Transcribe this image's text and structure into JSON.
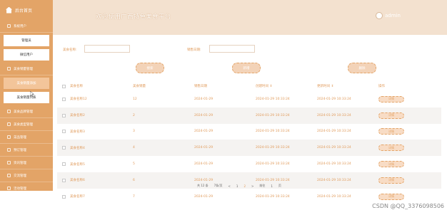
{
  "sidebar": {
    "home": "后台首页",
    "menu1": "系统用户",
    "sub1": [
      "管理员",
      "微信用户"
    ],
    "menu2": "美食销量管理",
    "sub2": [
      "美食销量添加",
      "美食销量列表"
    ],
    "menus": [
      "美食品牌管理",
      "美食类型管理",
      "菜品管理",
      "预订管理",
      "资讯管理",
      "交流管理",
      "活动管理"
    ]
  },
  "header": {
    "title": "欢迎使用广西特色美食平台",
    "user": "admin"
  },
  "search": {
    "name_label": "美食名称:",
    "date_label": "销售日期:",
    "btn_search": "搜索",
    "btn_add": "新增",
    "btn_delete": "删除"
  },
  "table": {
    "headers": [
      "美食名称",
      "美食销量",
      "销售日期",
      "创建时间",
      "更新时间",
      "操作"
    ],
    "sort_mark": "⇕",
    "rows": [
      {
        "name": "美食名称12",
        "count": "12",
        "date": "2024-01-29",
        "created": "2024-01-29 10:33:24",
        "updated": "2024-01-29 10:33:24",
        "action": "详情"
      },
      {
        "name": "美食名称2",
        "count": "2",
        "date": "2024-01-29",
        "created": "2024-01-29 10:33:24",
        "updated": "2024-01-29 10:33:24",
        "action": "详情"
      },
      {
        "name": "美食名称3",
        "count": "3",
        "date": "2024-01-29",
        "created": "2024-01-29 10:33:24",
        "updated": "2024-01-29 10:33:24",
        "action": "详情"
      },
      {
        "name": "美食名称4",
        "count": "4",
        "date": "2024-01-29",
        "created": "2024-01-29 10:33:24",
        "updated": "2024-01-29 10:33:24",
        "action": "详情"
      },
      {
        "name": "美食名称5",
        "count": "5",
        "date": "2024-01-29",
        "created": "2024-01-29 10:33:24",
        "updated": "2024-01-29 10:33:24",
        "action": "详情"
      },
      {
        "name": "美食名称6",
        "count": "6",
        "date": "2024-01-29",
        "created": "2024-01-29 10:33:24",
        "updated": "2024-01-29 10:33:24",
        "action": "详情"
      },
      {
        "name": "美食名称7",
        "count": "7",
        "date": "2024-01-29",
        "created": "2024-01-29 10:33:24",
        "updated": "2024-01-29 10:33:24",
        "action": "详情"
      }
    ]
  },
  "pager": {
    "total": "共 12 条",
    "per_page": "7条/页",
    "prev": "<",
    "page1": "1",
    "page2": "2",
    "next": ">",
    "goto": "前往",
    "page_input": "1",
    "page_unit": "页"
  },
  "watermark": "CSDN @QQ_3376098506",
  "colors": {
    "accent": "#e3a467",
    "header_bg": "#f3e1cf"
  }
}
